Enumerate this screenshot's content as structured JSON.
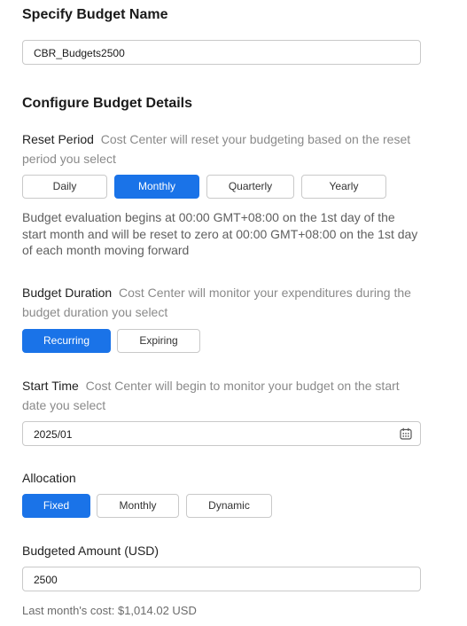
{
  "budget_name": {
    "heading": "Specify Budget Name",
    "value": "CBR_Budgets2500"
  },
  "details_heading": "Configure Budget Details",
  "reset_period": {
    "label": "Reset Period",
    "hint": "Cost Center will reset your budgeting based on the reset period you select",
    "options": [
      "Daily",
      "Monthly",
      "Quarterly",
      "Yearly"
    ],
    "selected": "Monthly",
    "description": "Budget evaluation begins at 00:00 GMT+08:00 on the 1st day of the start month and will be reset to zero at 00:00 GMT+08:00 on the 1st day of each month moving forward"
  },
  "budget_duration": {
    "label": "Budget Duration",
    "hint": "Cost Center will monitor your expenditures during the budget duration you select",
    "options": [
      "Recurring",
      "Expiring"
    ],
    "selected": "Recurring"
  },
  "start_time": {
    "label": "Start Time",
    "hint": "Cost Center will begin to monitor your budget on the start date you select",
    "value": "2025/01",
    "icon": "calendar-icon"
  },
  "allocation": {
    "label": "Allocation",
    "options": [
      "Fixed",
      "Monthly",
      "Dynamic"
    ],
    "selected": "Fixed"
  },
  "budgeted_amount": {
    "label": "Budgeted Amount (USD)",
    "value": "2500",
    "last_month_cost": "Last month's cost: $1,014.02 USD"
  },
  "colors": {
    "accent": "#1a73e8",
    "border": "#c9c9c9",
    "hint": "#8a8a8a"
  }
}
